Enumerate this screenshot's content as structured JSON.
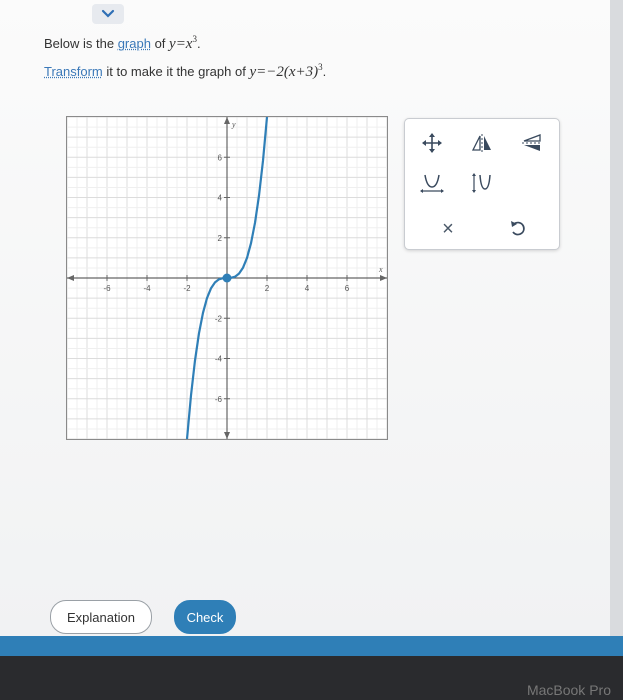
{
  "window": {
    "title": "Below is the graph of y=x^3."
  },
  "question": {
    "line1_prefix": "Below is the ",
    "line1_link": "graph",
    "line1_mid": " of ",
    "line1_math_base": "y=x",
    "line1_math_exp": "3",
    "line1_end": ".",
    "line2_link": "Transform",
    "line2_mid": " it to make it the graph of ",
    "line2_math_base": "y=−2(x+3)",
    "line2_math_exp": "3",
    "line2_end": "."
  },
  "graph": {
    "x_label": "x",
    "y_label": "y",
    "x_ticks": [
      "-6",
      "-4",
      "-2",
      "2",
      "4",
      "6"
    ],
    "y_ticks": [
      "6",
      "4",
      "2",
      "-2",
      "-4",
      "-6"
    ],
    "curve_color": "#2f7fb7",
    "point_color": "#2f7fb7"
  },
  "chart_data": {
    "type": "line",
    "xlim": [
      -8,
      8
    ],
    "ylim": [
      -8,
      8
    ],
    "grid": true,
    "function": "y = x^3",
    "key_point": [
      0,
      0
    ],
    "series": [
      {
        "x": [
          -2.0,
          -1.8,
          -1.6,
          -1.4,
          -1.2,
          -1.0,
          -0.8,
          -0.6,
          -0.4,
          -0.2,
          0,
          0.2,
          0.4,
          0.6,
          0.8,
          1.0,
          1.2,
          1.4,
          1.6,
          1.8,
          2.0
        ],
        "y": [
          -8.0,
          -5.832,
          -4.096,
          -2.744,
          -1.728,
          -1.0,
          -0.512,
          -0.216,
          -0.064,
          -0.008,
          0,
          0.008,
          0.064,
          0.216,
          0.512,
          1.0,
          1.728,
          2.744,
          4.096,
          5.832,
          8.0
        ]
      }
    ]
  },
  "tools": {
    "move": "move-icon",
    "reflect_y": "reflect-y-axis-icon",
    "reflect_x": "reflect-x-axis-icon",
    "stretch_h": "horizontal-stretch-icon",
    "stretch_v": "vertical-stretch-icon",
    "clear": "×",
    "undo": "undo-icon"
  },
  "buttons": {
    "explanation": "Explanation",
    "check": "Check"
  },
  "device": {
    "brand": "MacBook Pro"
  },
  "colors": {
    "accent": "#2f7fb7"
  }
}
